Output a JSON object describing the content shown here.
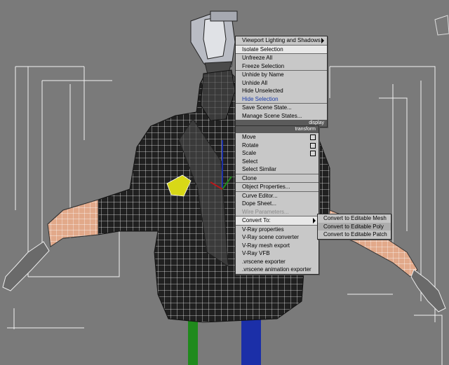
{
  "quad_menu_upper": {
    "items": [
      {
        "label": "Viewport Lighting and Shadows",
        "submenu": true
      },
      {
        "label": "Isolate Selection",
        "selected": true
      },
      {
        "label": "Unfreeze All"
      },
      {
        "label": "Freeze Selection"
      },
      {
        "label": "Unhide by Name"
      },
      {
        "label": "Unhide All"
      },
      {
        "label": "Hide Unselected"
      },
      {
        "label": "Hide Selection"
      },
      {
        "label": "Save Scene State..."
      },
      {
        "label": "Manage Scene States..."
      }
    ],
    "header": "display"
  },
  "quad_menu_lower": {
    "header": "transform",
    "items": [
      {
        "label": "Move"
      },
      {
        "label": "Rotate"
      },
      {
        "label": "Scale"
      },
      {
        "label": "Select"
      },
      {
        "label": "Select Similar"
      },
      {
        "label": "Clone"
      },
      {
        "label": "Object Properties..."
      },
      {
        "label": "Curve Editor..."
      },
      {
        "label": "Dope Sheet..."
      },
      {
        "label": "Wire Parameters..."
      },
      {
        "label": "Convert To:"
      },
      {
        "label": "V-Ray properties"
      },
      {
        "label": "V-Ray scene converter"
      },
      {
        "label": "V-Ray mesh export"
      },
      {
        "label": "V-Ray VFB"
      },
      {
        "label": ".vrscene exporter"
      },
      {
        "label": ".vrscene animation exporter"
      }
    ]
  },
  "convert_submenu": {
    "items": [
      {
        "label": "Convert to Editable Mesh"
      },
      {
        "label": "Convert to Editable Poly"
      },
      {
        "label": "Convert to Editable Patch"
      }
    ]
  },
  "colors": {
    "viewport_bg": "#7a7a7a",
    "menu_bg": "#c8c8c8",
    "header_bg": "#5b5b5b",
    "highlight_text": "#1a3aa8",
    "gizmo_red": "#b8171a",
    "gizmo_green": "#1f8a1c",
    "gizmo_blue": "#1b2fa8",
    "selection_yellow": "#d8d817"
  }
}
